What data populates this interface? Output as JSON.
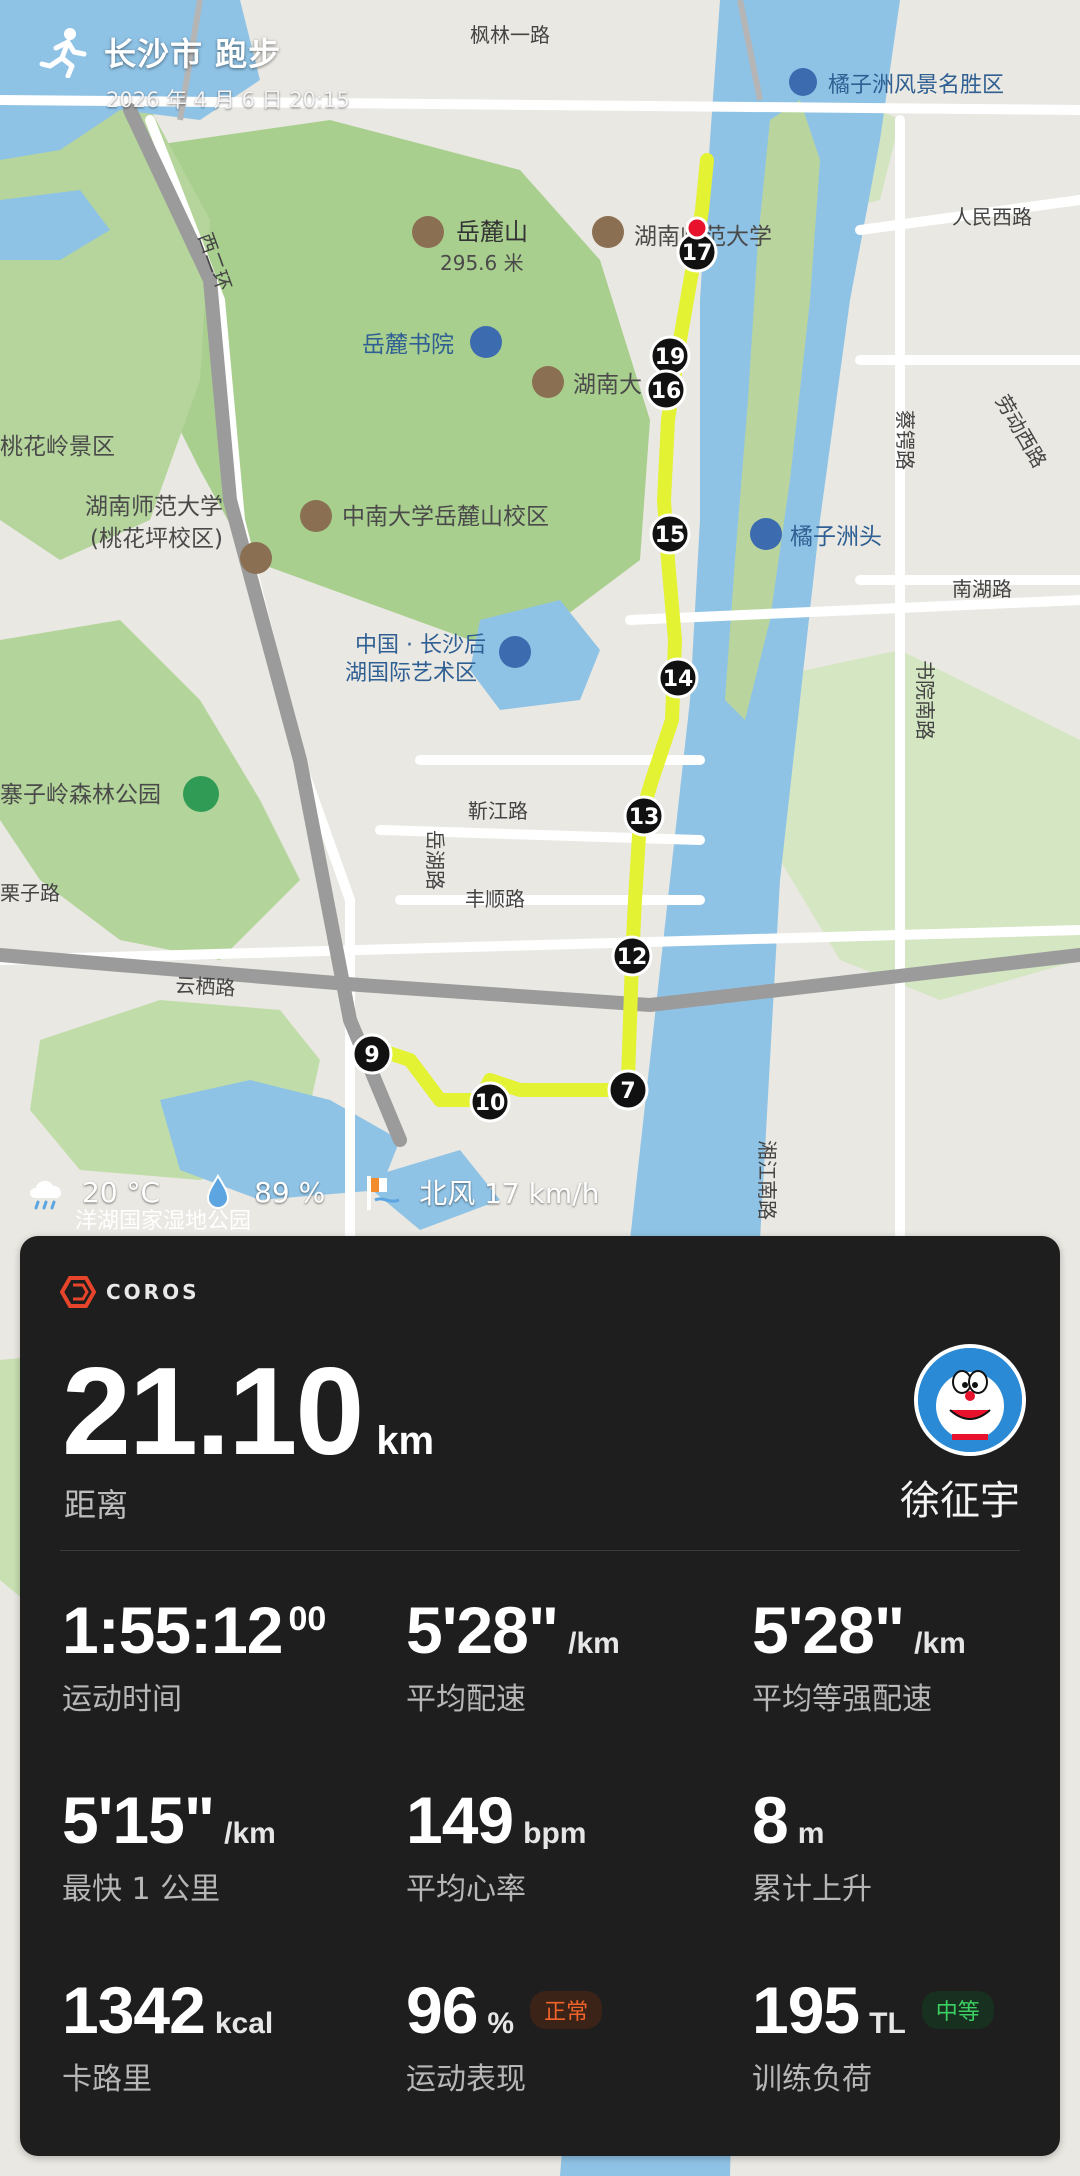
{
  "header": {
    "title": "长沙市 跑步",
    "datetime": "2026 年 4 月 6 日  20:15"
  },
  "map": {
    "pois": {
      "juzizhou_scenic": "橘子洲风景名胜区",
      "yuelu_mountain": "岳麓山",
      "yuelu_height": "295.6 米",
      "hunan_normal": "湖南师范大学",
      "yuelu_academy": "岳麓书院",
      "hunan_univ": "湖南大学",
      "csu": "中南大学岳麓山校区",
      "hunan_normal_tao_1": "湖南师范大学",
      "hunan_normal_tao_2": "(桃花坪校区)",
      "juzizhou_head": "橘子洲头",
      "art_district_1": "中国 · 长沙后",
      "art_district_2": "湖国际艺术区",
      "zhaiziling": "寨子岭森林公园",
      "taohualing": "桃花岭景区",
      "yanghu": "洋湖国家湿地公园"
    },
    "roads": {
      "fenglin": "枫林一路",
      "xierhuan": "西二环",
      "renmin": "人民西路",
      "laodong": "劳动西路",
      "huanghai": "南湖路",
      "cai_e": "蔡锷路",
      "shuyuan": "书院南路",
      "xinjiang": "靳江路",
      "yuehu": "岳湖路",
      "fengshun": "丰顺路",
      "yunqi": "云栖路",
      "xiangjiang": "湘江南路",
      "li": "栗子路"
    },
    "markers": [
      "7",
      "9",
      "10",
      "12",
      "13",
      "14",
      "15",
      "16",
      "17",
      "19"
    ],
    "route_color": "#e3f233",
    "water_color": "#8fc3e6"
  },
  "weather": {
    "temperature": "20 °C",
    "humidity": "89 %",
    "wind": "北风 17 km/h"
  },
  "card": {
    "brand": "COROS",
    "distance": {
      "value": "21.10",
      "unit": "km",
      "label": "距离"
    },
    "user": {
      "name": "徐征宇"
    },
    "stats": [
      {
        "id": "moving-time",
        "value": "1:55:12",
        "sup": "00",
        "unit": "",
        "label": "运动时间"
      },
      {
        "id": "avg-pace",
        "value": "5'28\"",
        "unit": "/km",
        "label": "平均配速"
      },
      {
        "id": "avg-grade-pace",
        "value": "5'28\"",
        "unit": "/km",
        "label": "平均等强配速"
      },
      {
        "id": "fastest-km",
        "value": "5'15\"",
        "unit": "/km",
        "label": "最快 1 公里"
      },
      {
        "id": "avg-hr",
        "value": "149",
        "unit": "bpm",
        "label": "平均心率"
      },
      {
        "id": "elevation-gain",
        "value": "8",
        "unit": "m",
        "label": "累计上升"
      },
      {
        "id": "calories",
        "value": "1342",
        "unit": "kcal",
        "label": "卡路里"
      },
      {
        "id": "performance",
        "value": "96",
        "unit": "%",
        "label": "运动表现",
        "badge": "正常"
      },
      {
        "id": "training-load",
        "value": "195",
        "unit": "TL",
        "label": "训练负荷",
        "badge": "中等"
      }
    ]
  },
  "colors": {
    "card_bg": "#1e1e1f",
    "badge_normal": "#f0632a",
    "badge_mid": "#3ccf62"
  }
}
